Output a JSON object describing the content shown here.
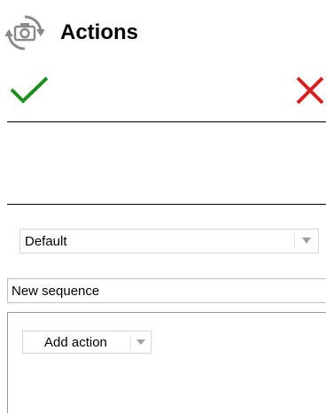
{
  "header": {
    "title": "Actions",
    "icon": "camera-rotate-icon"
  },
  "toolbar": {
    "ok_icon": "checkmark-icon",
    "cancel_icon": "close-icon",
    "ok_color": "#1f8f1f",
    "cancel_color": "#d42020"
  },
  "profile": {
    "selected": "Default"
  },
  "sequence": {
    "name": "New sequence"
  },
  "actions": {
    "add_label": "Add action"
  }
}
